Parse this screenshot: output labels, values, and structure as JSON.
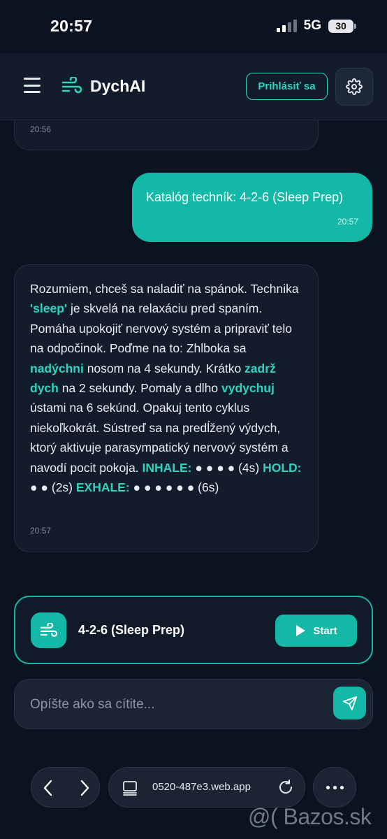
{
  "status_bar": {
    "time": "20:57",
    "network": "5G",
    "battery": "30"
  },
  "header": {
    "app_title": "DychAI",
    "login_label": "Prihlásiť sa",
    "icons": [
      "menu-icon",
      "wind-logo-icon",
      "gear-icon"
    ]
  },
  "chat": {
    "messages": [
      {
        "role": "assistant",
        "time": "20:56"
      },
      {
        "role": "user",
        "text": "Katalóg techník: 4-2-6 (Sleep Prep)",
        "time": "20:57"
      },
      {
        "role": "assistant",
        "time": "20:57",
        "segments": [
          "Rozumiem, chceš sa naladiť na spánok. Technika ",
          "'sleep'",
          " je skvelá na relaxáciu pred spaním. Pomáha upokojiť nervový systém a pripraviť telo na odpočinok. Poďme na to: Zhlboka sa ",
          "nadýchni",
          " nosom na 4 sekundy. Krátko ",
          "zadrž dych",
          " na 2 sekundy. Pomaly a dlho ",
          "vydychuj",
          " ústami na 6 sekúnd. Opakuj tento cyklus niekoľkokrát. Sústreď sa na predĺžený výdych, ktorý aktivuje parasympatický nervový systém a navodí pocit pokoja. ",
          "INHALE:",
          " ● ● ● ● (4s) ",
          "HOLD:",
          " ● ● (2s) ",
          "EXHALE:",
          " ● ● ● ● ● ● (6s)"
        ]
      }
    ]
  },
  "technique_card": {
    "name": "4-2-6 (Sleep Prep)",
    "start_label": "Start"
  },
  "composer": {
    "placeholder": "Opíšte ako sa cítite..."
  },
  "browser": {
    "url": "0520-487e3.web.app"
  },
  "watermark": "@( Bazos.sk",
  "colors": {
    "accent": "#14b8a6",
    "background": "#0b1220",
    "bubble": "#131c2b"
  }
}
